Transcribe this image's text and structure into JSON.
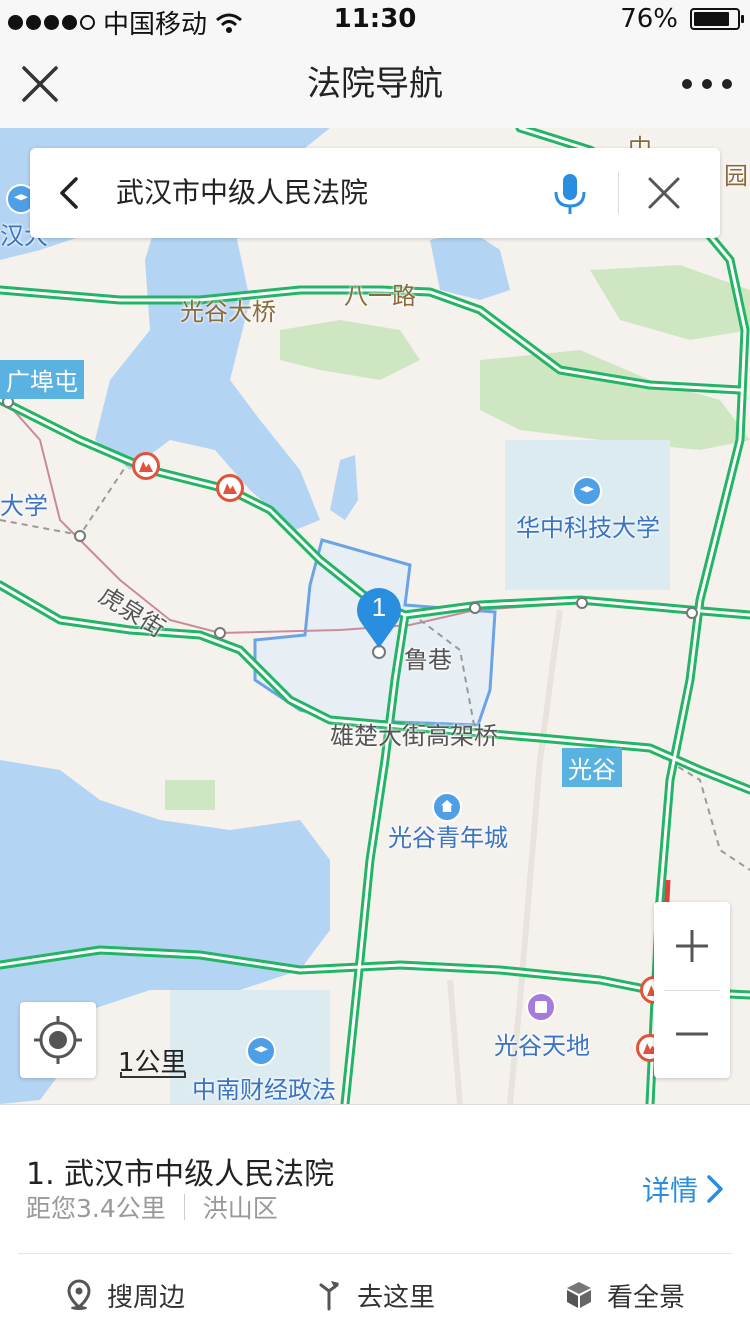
{
  "status_bar": {
    "carrier": "中国移动",
    "time": "11:30",
    "battery": "76%",
    "battery_level": 0.76
  },
  "nav": {
    "title": "法院导航",
    "close_icon": "close-icon",
    "more_icon": "more-icon"
  },
  "search": {
    "query": "武汉市中级人民法院",
    "back_icon": "chevron-left-icon",
    "voice_icon": "microphone-icon",
    "clear_icon": "close-icon"
  },
  "map": {
    "labels": {
      "bridge": "光谷大桥",
      "road_bayi": "八一路",
      "district_guangbutun": "广埠屯",
      "university_partial": "大学",
      "university_partial_top": "汉大",
      "hust": "华中科技大学",
      "huquan_street": "虎泉街",
      "lu_xiang": "鲁巷",
      "xiongchu": "雄楚大街高架桥",
      "guanggu_tag": "光谷",
      "youth_city": "光谷青年城",
      "tiandi": "光谷天地",
      "znufe": "中南财经政法",
      "top_right": "中",
      "top_right_2": "园"
    },
    "marker": {
      "number": "1",
      "color": "#2a8ee0"
    },
    "scale": "1公里",
    "zoom_in": "+",
    "zoom_out": "−",
    "colors": {
      "road": "#23b565",
      "water": "#b3d4f2",
      "green": "#cfe6c3",
      "boundary": "#6aa4e6"
    }
  },
  "result": {
    "title": "1. 武汉市中级人民法院",
    "distance": "距您3.4公里",
    "district": "洪山区",
    "detail": "详情"
  },
  "actions": [
    {
      "label": "搜周边",
      "icon": "location-pin-icon"
    },
    {
      "label": "去这里",
      "icon": "route-icon"
    },
    {
      "label": "看全景",
      "icon": "cube-icon"
    }
  ]
}
